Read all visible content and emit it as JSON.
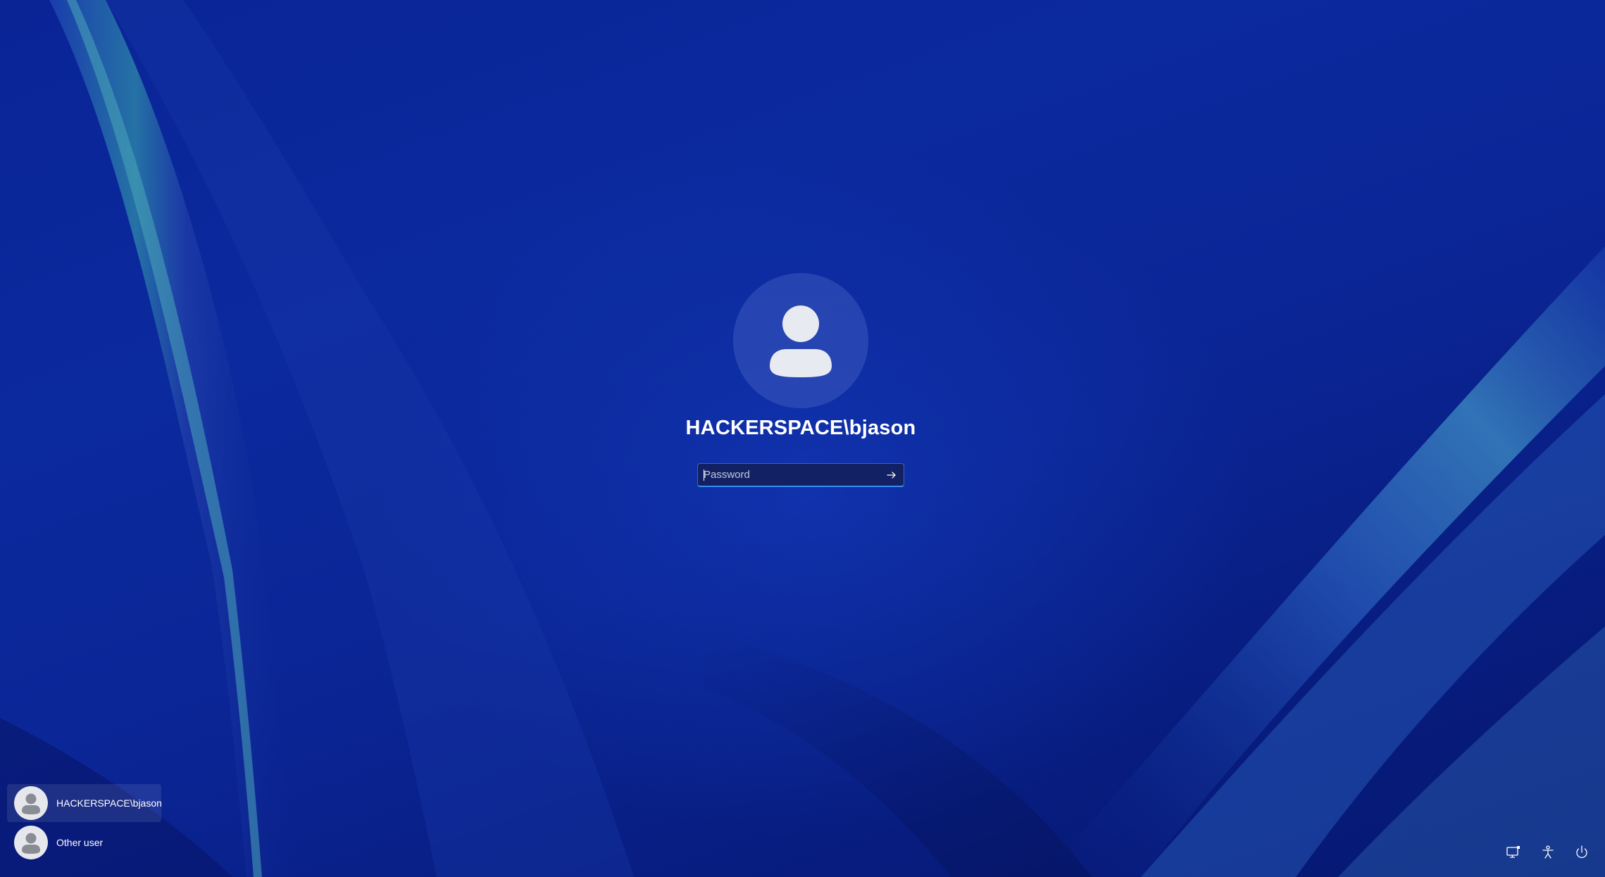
{
  "login": {
    "account_name": "HACKERSPACE\\bjason",
    "password_placeholder": "Password",
    "password_value": ""
  },
  "user_switcher": {
    "users": [
      {
        "label": "HACKERSPACE\\bjason",
        "selected": true
      },
      {
        "label": "Other user",
        "selected": false
      }
    ]
  },
  "tray": {
    "icons": [
      "network-icon",
      "accessibility-icon",
      "power-icon"
    ]
  },
  "colors": {
    "background": "#0a2496",
    "accent": "#3a8ff0",
    "text": "#ffffff"
  }
}
